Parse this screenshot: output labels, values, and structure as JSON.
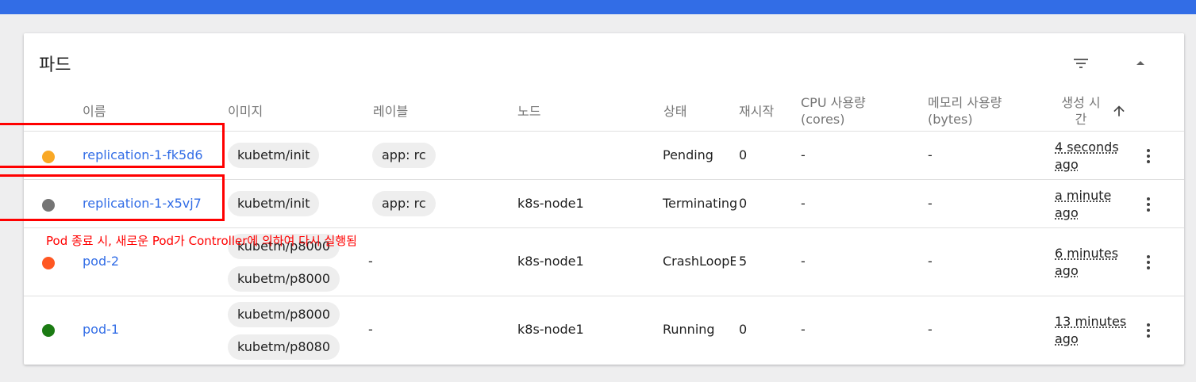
{
  "colors": {
    "accent": "#326de6",
    "status_pending": "#f9a825",
    "status_terminating": "#757575",
    "status_error": "#ff5722",
    "status_running": "#1b7b13",
    "annotation_red": "#ff0000"
  },
  "card": {
    "title": "파드",
    "filter_icon": "filter-list-icon",
    "collapse_icon": "chevron-up-icon"
  },
  "table": {
    "headers": {
      "name": "이름",
      "images": "이미지",
      "labels": "레이블",
      "node": "노드",
      "status": "상태",
      "restarts": "재시작",
      "cpu_1": "CPU 사용량",
      "cpu_2": "(cores)",
      "memory_1": "메모리 사용량",
      "memory_2": "(bytes)",
      "created_1": "생성 시",
      "created_2": "간",
      "sort_icon": "arrow-upward-icon"
    },
    "rows": [
      {
        "status_color": "status_pending",
        "name": "replication-1-fk5d6",
        "images": [
          "kubetm/init"
        ],
        "labels": [
          "app: rc"
        ],
        "node": "",
        "status": "Pending",
        "restarts": "0",
        "cpu": "-",
        "memory": "-",
        "age_1": "4 seconds",
        "age_2": "ago"
      },
      {
        "status_color": "status_terminating",
        "name": "replication-1-x5vj7",
        "images": [
          "kubetm/init"
        ],
        "labels": [
          "app: rc"
        ],
        "node": "k8s-node1",
        "status": "Terminating",
        "restarts": "0",
        "cpu": "-",
        "memory": "-",
        "age_1": "a minute",
        "age_2": "ago"
      },
      {
        "status_color": "status_error",
        "name": "pod-2",
        "images": [
          "kubetm/p8000",
          "kubetm/p8000"
        ],
        "labels": "-",
        "node": "k8s-node1",
        "status": "CrashLoopE",
        "restarts": "5",
        "cpu": "-",
        "memory": "-",
        "age_1": "6 minutes",
        "age_2": "ago"
      },
      {
        "status_color": "status_running",
        "name": "pod-1",
        "images": [
          "kubetm/p8000",
          "kubetm/p8080"
        ],
        "labels": "-",
        "node": "k8s-node1",
        "status": "Running",
        "restarts": "0",
        "cpu": "-",
        "memory": "-",
        "age_1": "13 minutes",
        "age_2": "ago"
      }
    ]
  },
  "annotation": {
    "text": "Pod 종료 시, 새로운 Pod가 Controller에 의하여 다시 실행됨"
  }
}
